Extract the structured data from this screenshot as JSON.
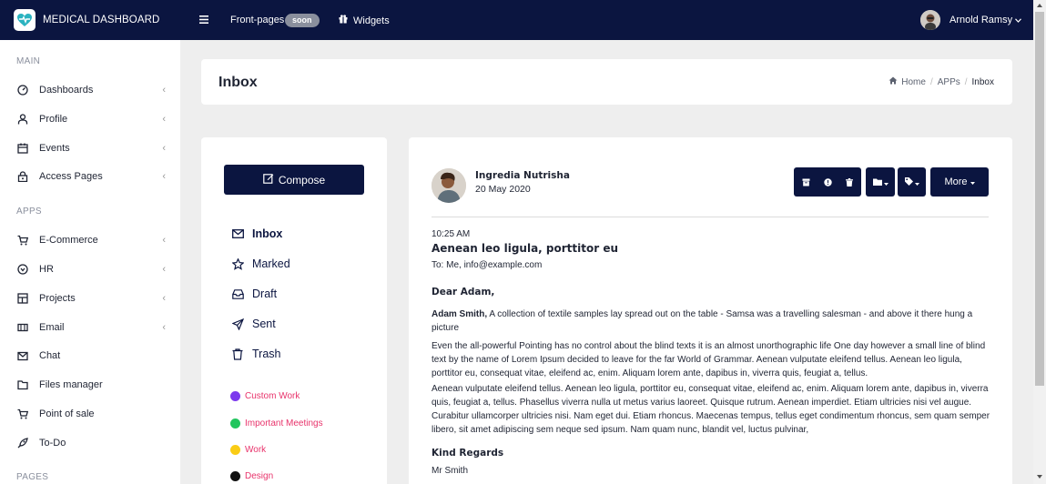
{
  "topbar": {
    "brand": "MEDICAL DASHBOARD",
    "front_pages": "Front-pages",
    "soon_badge": "soon",
    "widgets": "Widgets",
    "user_name": "Arnold Ramsy"
  },
  "sidebar": {
    "sections": [
      "MAIN",
      "APPS",
      "PAGES"
    ],
    "main_items": [
      {
        "label": "Dashboards",
        "icon": "gauge-icon",
        "has_chevron": true
      },
      {
        "label": "Profile",
        "icon": "user-icon",
        "has_chevron": true
      },
      {
        "label": "Events",
        "icon": "calendar-icon",
        "has_chevron": true
      },
      {
        "label": "Access Pages",
        "icon": "lock-icon",
        "has_chevron": true
      }
    ],
    "app_items": [
      {
        "label": "E-Commerce",
        "icon": "cart-icon",
        "has_chevron": true
      },
      {
        "label": "HR",
        "icon": "shield-icon",
        "has_chevron": true
      },
      {
        "label": "Projects",
        "icon": "layout-icon",
        "has_chevron": true
      },
      {
        "label": "Email",
        "icon": "email-icon",
        "has_chevron": true
      },
      {
        "label": "Chat",
        "icon": "envelope-open-icon",
        "has_chevron": false
      },
      {
        "label": "Files manager",
        "icon": "folder-icon",
        "has_chevron": false
      },
      {
        "label": "Point of sale",
        "icon": "cart-icon",
        "has_chevron": false
      },
      {
        "label": "To-Do",
        "icon": "rocket-icon",
        "has_chevron": false
      }
    ]
  },
  "page": {
    "title": "Inbox",
    "breadcrumb": [
      "Home",
      "APPs",
      "Inbox"
    ]
  },
  "mailbox": {
    "compose_label": "Compose",
    "folders": [
      {
        "label": "Inbox",
        "icon": "mail-icon",
        "active": true
      },
      {
        "label": "Marked",
        "icon": "star-icon",
        "active": false
      },
      {
        "label": "Draft",
        "icon": "draft-icon",
        "active": false
      },
      {
        "label": "Sent",
        "icon": "send-icon",
        "active": false
      },
      {
        "label": "Trash",
        "icon": "trash-icon",
        "active": false
      }
    ],
    "labels": [
      {
        "label": "Custom Work",
        "color": "#7c3aed"
      },
      {
        "label": "Important Meetings",
        "color": "#22c55e"
      },
      {
        "label": "Work",
        "color": "#facc15"
      },
      {
        "label": "Design",
        "color": "#111111"
      }
    ]
  },
  "mail": {
    "sender_name": "Ingredia Nutrisha",
    "date": "20 May 2020",
    "time": "10:25 AM",
    "subject": "Aenean leo ligula, porttitor eu",
    "to": "To: Me, info@example.com",
    "greeting": "Dear Adam,",
    "para1_lead": "Adam Smith,",
    "para1": " A collection of textile samples lay spread out on the table - Samsa was a travelling salesman - and above it there hung a picture",
    "para2": "Even the all-powerful Pointing has no control about the blind texts it is an almost unorthographic life One day however a small line of blind text by the name of Lorem Ipsum decided to leave for the far World of Grammar. Aenean vulputate eleifend tellus. Aenean leo ligula, porttitor eu, consequat vitae, eleifend ac, enim. Aliquam lorem ante, dapibus in, viverra quis, feugiat a, tellus.",
    "para3": "Aenean vulputate eleifend tellus. Aenean leo ligula, porttitor eu, consequat vitae, eleifend ac, enim. Aliquam lorem ante, dapibus in, viverra quis, feugiat a, tellus. Phasellus viverra nulla ut metus varius laoreet. Quisque rutrum. Aenean imperdiet. Etiam ultricies nisi vel augue. Curabitur ullamcorper ultricies nisi. Nam eget dui. Etiam rhoncus. Maecenas tempus, tellus eget condimentum rhoncus, sem quam semper libero, sit amet adipiscing sem neque sed ipsum. Nam quam nunc, blandit vel, luctus pulvinar,",
    "closing": "Kind Regards",
    "signature": "Mr Smith",
    "more_label": "More"
  },
  "colors": {
    "navy": "#0b1540",
    "label_text": "#e8336b",
    "background": "#eeeeee"
  }
}
